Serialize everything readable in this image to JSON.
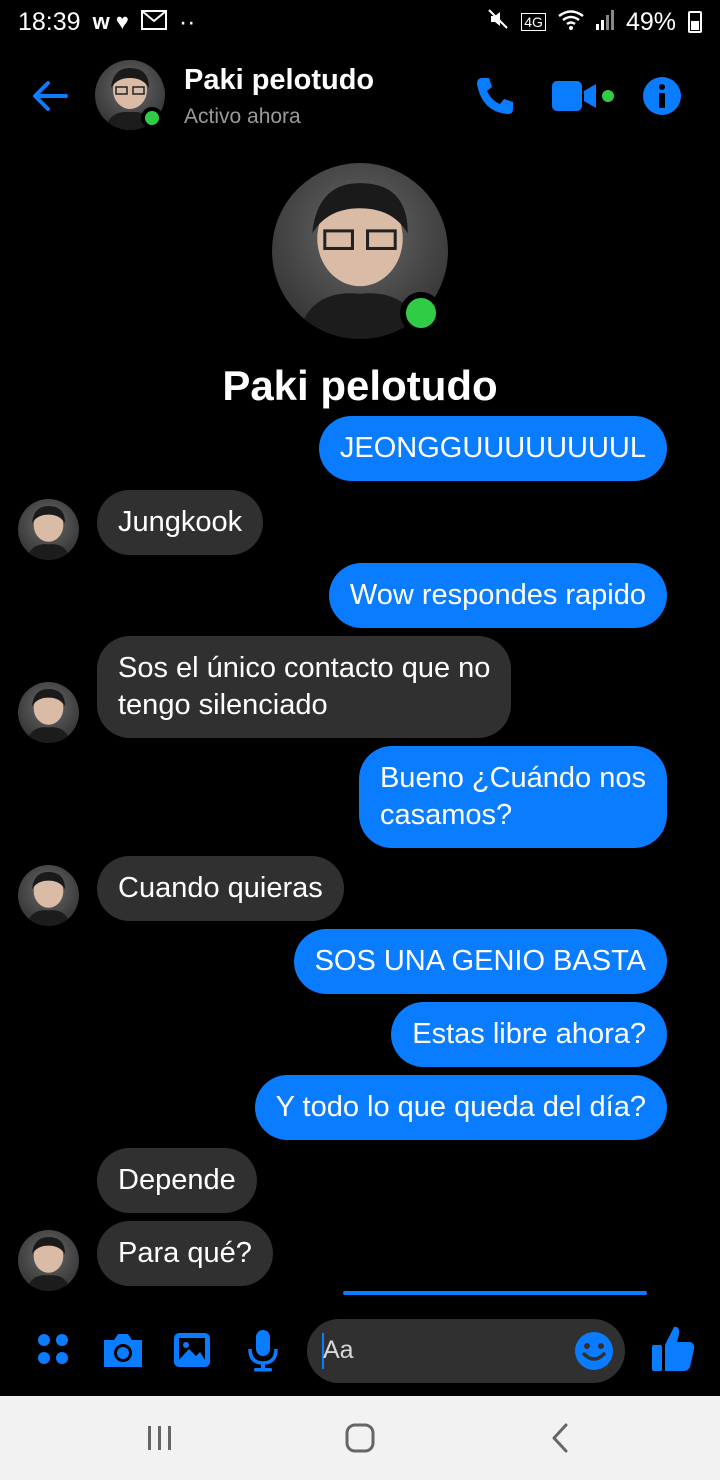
{
  "status_bar": {
    "time": "18:39",
    "notif_glyphs": "w ♥",
    "dots": "··",
    "network": "4G",
    "battery": "49%"
  },
  "header": {
    "name": "Paki pelotudo",
    "status": "Activo ahora"
  },
  "profile": {
    "name": "Paki pelotudo"
  },
  "messages": [
    {
      "from": "me",
      "text": "JEONGGUUUUUUUUL"
    },
    {
      "from": "them",
      "text": "Jungkook"
    },
    {
      "from": "me",
      "text": "Wow respondes rapido"
    },
    {
      "from": "them",
      "text_line1": "Sos el único contacto que no",
      "text_line2": "tengo silenciado"
    },
    {
      "from": "me",
      "text_line1": "Bueno ¿Cuándo nos",
      "text_line2": "casamos?"
    },
    {
      "from": "them",
      "text": "Cuando quieras"
    },
    {
      "from": "me",
      "text": "SOS UNA GENIO BASTA"
    },
    {
      "from": "me",
      "text": "Estas libre ahora?"
    },
    {
      "from": "me",
      "text": "Y todo lo que queda del día?"
    },
    {
      "from": "them",
      "text": "Depende"
    },
    {
      "from": "them",
      "text": "Para qué?"
    }
  ],
  "composer": {
    "placeholder": "Aa"
  },
  "colors": {
    "accent": "#0a7cff",
    "online": "#31cc46",
    "incoming_bubble": "#303030"
  }
}
